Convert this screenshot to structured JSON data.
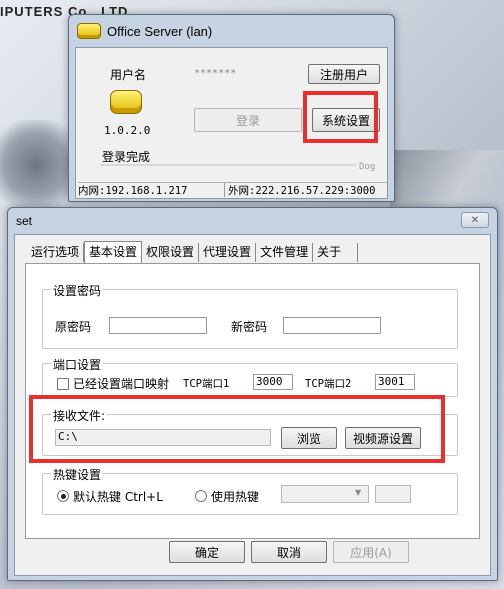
{
  "background": {
    "text": "IPUTERS Co., LTD."
  },
  "login_window": {
    "title": "Office Server (lan)",
    "username_label": "用户名",
    "username_value": "*******",
    "register_button": "注册用户",
    "version": "1.0.2.0",
    "login_button": "登录",
    "system_settings_button": "系统设置",
    "status_text": "登录完成",
    "watermark": "Dog",
    "lan_ip": "内网:192.168.1.217",
    "wan_ip": "外网:222.216.57.229:3000"
  },
  "settings_window": {
    "title": "set",
    "close_symbol": "✕",
    "tabs": [
      {
        "label": "运行选项",
        "active": false
      },
      {
        "label": "基本设置",
        "active": true
      },
      {
        "label": "权限设置",
        "active": false
      },
      {
        "label": "代理设置",
        "active": false
      },
      {
        "label": "文件管理",
        "active": false
      },
      {
        "label": "关于",
        "active": false
      }
    ],
    "password_group": {
      "label": "设置密码",
      "old_password_label": "原密码",
      "new_password_label": "新密码",
      "old_password_value": "",
      "new_password_value": ""
    },
    "port_group": {
      "label": "端口设置",
      "mapped_checkbox_label": "已经设置端口映射",
      "mapped_checked": false,
      "tcp_port1_label": "TCP端口1",
      "tcp_port1_value": "3000",
      "tcp_port2_label": "TCP端口2",
      "tcp_port2_value": "3001"
    },
    "receive_group": {
      "label": "接收文件:",
      "path_value": "C:\\",
      "browse_button": "浏览",
      "video_source_button": "视频源设置"
    },
    "hotkey_group": {
      "label": "热键设置",
      "default_option": "默认热键 Ctrl+L",
      "default_selected": true,
      "custom_option": "使用热键",
      "custom_selected": false,
      "custom_key_value": ""
    },
    "buttons": {
      "ok": "确定",
      "cancel": "取消",
      "apply": "应用(A)"
    }
  },
  "colors": {
    "highlight": "#e8302e",
    "window_frame": "#c6d3e2"
  }
}
